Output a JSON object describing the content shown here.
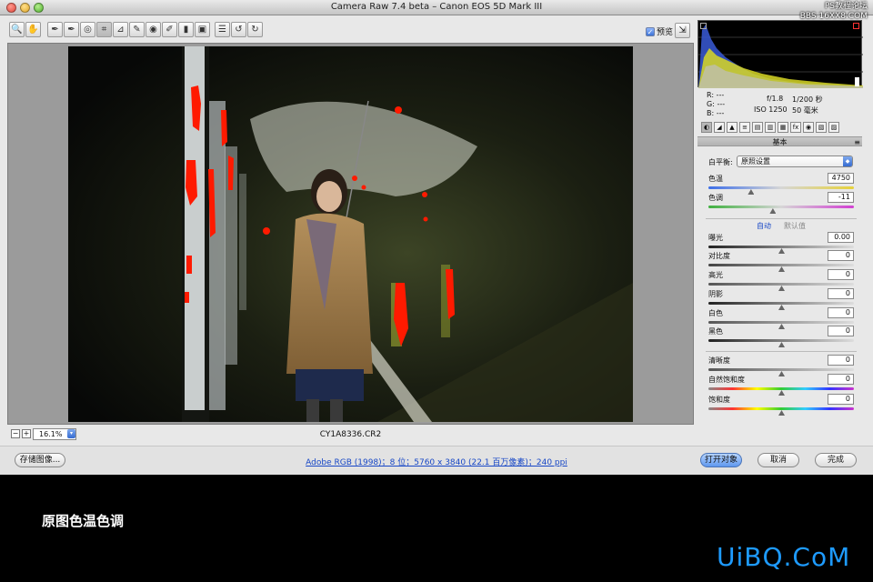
{
  "window": {
    "title": "Camera Raw 7.4 beta –  Canon EOS 5D Mark III",
    "watermark_line1": "PS教程论坛",
    "watermark_line2": "BBS.16XX8.COM"
  },
  "toolbar": {
    "tools": [
      {
        "name": "zoom-tool",
        "glyph": "🔍"
      },
      {
        "name": "hand-tool",
        "glyph": "✋"
      },
      {
        "name": "white-balance-tool",
        "glyph": "✒"
      },
      {
        "name": "color-sampler-tool",
        "glyph": "✒"
      },
      {
        "name": "targeted-adjustment-tool",
        "glyph": "◎"
      },
      {
        "name": "crop-tool",
        "glyph": "⌗"
      },
      {
        "name": "straighten-tool",
        "glyph": "⊿"
      },
      {
        "name": "spot-removal-tool",
        "glyph": "✎"
      },
      {
        "name": "red-eye-tool",
        "glyph": "◉"
      },
      {
        "name": "adjustment-brush-tool",
        "glyph": "✐"
      },
      {
        "name": "graduated-filter-tool",
        "glyph": "▮"
      },
      {
        "name": "radial-filter-tool",
        "glyph": "▣"
      },
      {
        "name": "preferences-tool",
        "glyph": "☰"
      },
      {
        "name": "rotate-ccw-tool",
        "glyph": "↺"
      },
      {
        "name": "rotate-cw-tool",
        "glyph": "↻"
      }
    ],
    "preview_label": "预览",
    "preview_checked": true
  },
  "status": {
    "zoom_value": "16.1%",
    "filename": "CY1A8336.CR2"
  },
  "info": {
    "r": "R:  ---",
    "g": "G:  ---",
    "b": "B:  ---",
    "aperture": "f/1.8",
    "shutter": "1/200 秒",
    "iso": "ISO 1250",
    "focal": "50 毫米"
  },
  "panel": {
    "title": "基本",
    "white_balance_label": "白平衡:",
    "white_balance_value": "原照设置",
    "auto_label": "自动",
    "default_label": "默认值",
    "sliders": [
      {
        "label": "色温",
        "value": "4750",
        "fraction": 0.29
      },
      {
        "label": "色调",
        "value": "-11",
        "fraction": 0.44
      },
      {
        "label": "曝光",
        "value": "0.00",
        "fraction": 0.5
      },
      {
        "label": "对比度",
        "value": "0",
        "fraction": 0.5
      },
      {
        "label": "高光",
        "value": "0",
        "fraction": 0.5
      },
      {
        "label": "阴影",
        "value": "0",
        "fraction": 0.5
      },
      {
        "label": "白色",
        "value": "0",
        "fraction": 0.5
      },
      {
        "label": "黑色",
        "value": "0",
        "fraction": 0.5
      },
      {
        "label": "清晰度",
        "value": "0",
        "fraction": 0.5
      },
      {
        "label": "自然饱和度",
        "value": "0",
        "fraction": 0.5
      },
      {
        "label": "饱和度",
        "value": "0",
        "fraction": 0.5
      }
    ]
  },
  "bottom": {
    "save_label": "存储图像...",
    "workflow_link": "Adobe RGB (1998)；8 位；5760 x 3840 (22.1 百万像素)；240 ppi",
    "open_label": "打开对象",
    "cancel_label": "取消",
    "done_label": "完成"
  },
  "caption": {
    "text": "原图色温色调",
    "brand": "UiBQ.CoM"
  },
  "colors": {
    "accent_blue": "#3e74d6",
    "clipping_red": "#ff1a00",
    "brand_blue": "#1e9bff"
  }
}
